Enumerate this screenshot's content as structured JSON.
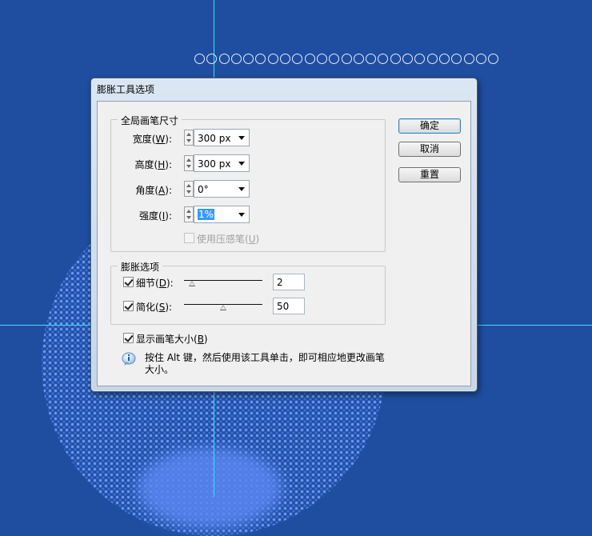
{
  "dialog": {
    "title": "膨胀工具选项",
    "global_brush": {
      "legend": "全局画笔尺寸",
      "width": {
        "label": "宽度(",
        "key": "W",
        "end": "):",
        "value": "300 px"
      },
      "height": {
        "label": "高度(",
        "key": "H",
        "end": "):",
        "value": "300 px"
      },
      "angle": {
        "label": "角度(",
        "key": "A",
        "end": "):",
        "value": "0°"
      },
      "intensity": {
        "label": "强度(",
        "key": "I",
        "end": "):",
        "value": "1%"
      },
      "use_pressure": {
        "label": "使用压感笔(",
        "key": "U",
        "end": ")",
        "checked": false,
        "enabled": false
      }
    },
    "bloat_options": {
      "legend": "膨胀选项",
      "detail": {
        "label": "细节(",
        "key": "D",
        "end": "):",
        "checked": true,
        "value": "2",
        "slider_fraction": 0.1
      },
      "simplify": {
        "label": "简化(",
        "key": "S",
        "end": "):",
        "checked": true,
        "value": "50",
        "slider_fraction": 0.5
      }
    },
    "show_brush_size": {
      "label": "显示画笔大小(",
      "key": "B",
      "end": ")",
      "checked": true
    },
    "tip_text": "按住 Alt 键，然后使用该工具单击，即可相应地更改画笔大小。",
    "buttons": {
      "ok": "确定",
      "cancel": "取消",
      "reset": "重置"
    }
  },
  "icons": {
    "info": "info-icon"
  },
  "colors": {
    "artboard": "#1f4ea1",
    "guide": "#3fe0ef",
    "selection": "#3399ff"
  }
}
